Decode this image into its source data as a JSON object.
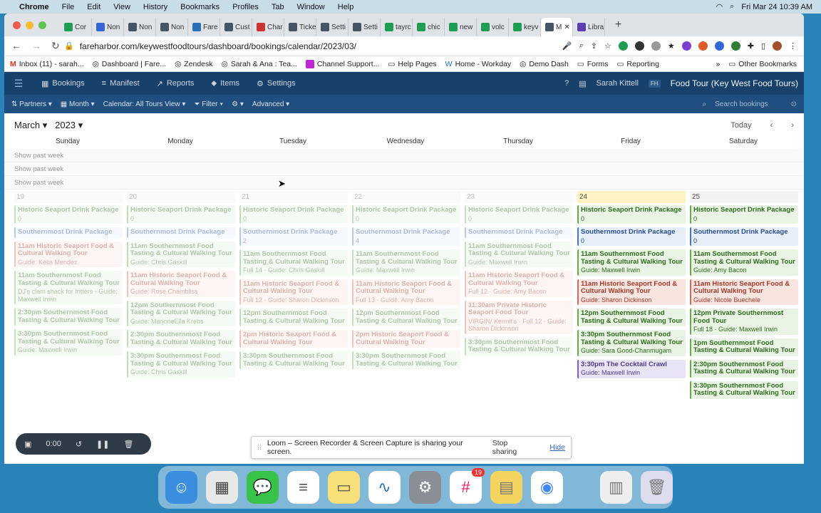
{
  "menubar": {
    "app": "Chrome",
    "items": [
      "File",
      "Edit",
      "View",
      "History",
      "Bookmarks",
      "Profiles",
      "Tab",
      "Window",
      "Help"
    ],
    "clock": "Fri Mar 24  10:39 AM"
  },
  "tabs": [
    "Cor",
    "Non",
    "Non",
    "Non",
    "Fare",
    "Cust",
    "Char",
    "Ticke",
    "Setti",
    "Setti",
    "tayrc",
    "chic",
    "new",
    "volc",
    "keyv",
    "M",
    "Libra"
  ],
  "url": "fareharbor.com/keywestfoodtours/dashboard/bookings/calendar/2023/03/",
  "bookmarks": [
    "Inbox (11) - sarah...",
    "Dashboard | Fare...",
    "Zendesk",
    "Sarah & Ana : Tea...",
    "Channel Support...",
    "Help Pages",
    "Home - Workday",
    "Demo Dash",
    "Forms",
    "Reporting"
  ],
  "other_bookmarks": "Other Bookmarks",
  "nav": {
    "items": [
      "Bookings",
      "Manifest",
      "Reports",
      "Items",
      "Settings"
    ],
    "user": "Sarah Kittell",
    "user_tag": "FH",
    "brand": "Food Tour (Key West Food Tours)"
  },
  "filters": {
    "partners": "Partners",
    "month": "Month",
    "calendar": "Calendar: All Tours View",
    "filter": "Filter",
    "advanced": "Advanced",
    "search_placeholder": "Search bookings"
  },
  "calendar": {
    "month": "March",
    "year": "2023",
    "today": "Today",
    "weekdays": [
      "Sunday",
      "Monday",
      "Tuesday",
      "Wednesday",
      "Thursday",
      "Friday",
      "Saturday"
    ],
    "show_past_week": "Show past week",
    "days": [
      {
        "num": "19",
        "events": [
          {
            "c": "green",
            "t": "Historic Seaport Drink Package",
            "g": "0"
          },
          {
            "c": "blue",
            "t": "Southernmost Drink Package",
            "g": ""
          },
          {
            "c": "red",
            "t": "11am Historic Seaport Food & Cultural Walking Tour",
            "g": "Guide: Kelia Mendez"
          },
          {
            "c": "green",
            "t": "11am Southernmost Food Tasting & Cultural Walking Tour",
            "g": "DJ's clam shack for fritters · Guide: Maxwell Irwin"
          },
          {
            "c": "green",
            "t": "2:30pm Southernmost Food Tasting & Cultural Walking Tour",
            "g": ""
          },
          {
            "c": "green",
            "t": "3:30pm Southernmost Food Tasting & Cultural Walking Tour",
            "g": "Guide: Maxwell Irwin"
          }
        ]
      },
      {
        "num": "20",
        "events": [
          {
            "c": "green",
            "t": "Historic Seaport Drink Package",
            "g": "0"
          },
          {
            "c": "blue",
            "t": "Southernmost Drink Package",
            "g": ""
          },
          {
            "c": "green",
            "t": "11am Southernmost Food Tasting & Cultural Walking Tour",
            "g": "Guide: Chris Gaskill"
          },
          {
            "c": "red",
            "t": "11am Historic Seaport Food & Cultural Walking Tour",
            "g": "Guide: Rose Chambliss"
          },
          {
            "c": "green",
            "t": "12pm Southernmost Food Tasting & Cultural Walking Tour",
            "g": "Guide: MarjorieElla Krebs"
          },
          {
            "c": "green",
            "t": "2:30pm Southernmost Food Tasting & Cultural Walking Tour",
            "g": ""
          },
          {
            "c": "green",
            "t": "3:30pm Southernmost Food Tasting & Cultural Walking Tour",
            "g": "Guide: Chris Gaskill"
          }
        ]
      },
      {
        "num": "21",
        "events": [
          {
            "c": "green",
            "t": "Historic Seaport Drink Package",
            "g": "0"
          },
          {
            "c": "blue",
            "t": "Southernmost Drink Package",
            "g": "2"
          },
          {
            "c": "green",
            "t": "11am Southernmost Food Tasting & Cultural Walking Tour",
            "g": "Full 14 · Guide: Chris Gaskill"
          },
          {
            "c": "red",
            "t": "11am Historic Seaport Food & Cultural Walking Tour",
            "g": "Full 12 · Guide: Sharon Dickinson"
          },
          {
            "c": "green",
            "t": "12pm Southernmost Food Tasting & Cultural Walking Tour",
            "g": ""
          },
          {
            "c": "red",
            "t": "2pm Historic Seaport Food & Cultural Walking Tour",
            "g": ""
          },
          {
            "c": "green",
            "t": "3:30pm Southernmost Food Tasting & Cultural Walking Tour",
            "g": ""
          }
        ]
      },
      {
        "num": "22",
        "events": [
          {
            "c": "green",
            "t": "Historic Seaport Drink Package",
            "g": "0"
          },
          {
            "c": "blue",
            "t": "Southernmost Drink Package",
            "g": "4"
          },
          {
            "c": "green",
            "t": "11am Southernmost Food Tasting & Cultural Walking Tour",
            "g": "Guide: Maxwell Irwin"
          },
          {
            "c": "red",
            "t": "11am Historic Seaport Food & Cultural Walking Tour",
            "g": "Full 13 · Guide: Amy Bacon"
          },
          {
            "c": "green",
            "t": "12pm Southernmost Food Tasting & Cultural Walking Tour",
            "g": ""
          },
          {
            "c": "red",
            "t": "2pm Historic Seaport Food & Cultural Walking Tour",
            "g": ""
          },
          {
            "c": "green",
            "t": "3:30pm Southernmost Food Tasting & Cultural Walking Tour",
            "g": ""
          }
        ]
      },
      {
        "num": "23",
        "events": [
          {
            "c": "green",
            "t": "Historic Seaport Drink Package",
            "g": "0"
          },
          {
            "c": "blue",
            "t": "Southernmost Drink Package",
            "g": ""
          },
          {
            "c": "green",
            "t": "11am Southernmost Food Tasting & Cultural Walking Tour",
            "g": "Guide: Maxwell Irwin"
          },
          {
            "c": "red",
            "t": "11am Historic Seaport Food & Cultural Walking Tour",
            "g": "Full 12 · Guide: Amy Bacon"
          },
          {
            "c": "red",
            "t": "11:30am Private Historic Seaport Food Tour",
            "g": "VIRGIN/ Kermit's · Full 12 · Guide: Sharon Dickinson"
          },
          {
            "c": "green",
            "t": "3:30pm Southernmost Food Tasting & Cultural Walking Tour",
            "g": ""
          }
        ]
      },
      {
        "num": "24",
        "events": [
          {
            "c": "green",
            "t": "Historic Seaport Drink Package",
            "g": "0"
          },
          {
            "c": "blue",
            "t": "Southernmost Drink Package",
            "g": "0"
          },
          {
            "c": "green",
            "t": "11am Southernmost Food Tasting & Cultural Walking Tour",
            "g": "Guide: Maxwell Irwin"
          },
          {
            "c": "red",
            "t": "11am Historic Seaport Food & Cultural Walking Tour",
            "g": "Guide: Sharon Dickinson"
          },
          {
            "c": "green",
            "t": "12pm Southernmost Food Tasting & Cultural Walking Tour",
            "g": ""
          },
          {
            "c": "green",
            "t": "3:30pm Southernmost Food Tasting & Cultural Walking Tour",
            "g": "Guide: Sara Good-Chanmugam"
          },
          {
            "c": "purple",
            "t": "3:30pm The Cocktail Crawl",
            "g": "Guide: Maxwell Irwin"
          }
        ]
      },
      {
        "num": "25",
        "events": [
          {
            "c": "green",
            "t": "Historic Seaport Drink Package",
            "g": "0"
          },
          {
            "c": "blue",
            "t": "Southernmost Drink Package",
            "g": "0"
          },
          {
            "c": "green",
            "t": "11am Southernmost Food Tasting & Cultural Walking Tour",
            "g": "Guide: Amy Bacon"
          },
          {
            "c": "red",
            "t": "11am Historic Seaport Food & Cultural Walking Tour",
            "g": "Guide: Nicole Buechele"
          },
          {
            "c": "green",
            "t": "12pm Private Southernmost Food Tour",
            "g": "Full 18 · Guide: Maxwell Irwin"
          },
          {
            "c": "green",
            "t": "1pm Southernmost Food Tasting & Cultural Walking Tour",
            "g": ""
          },
          {
            "c": "green",
            "t": "2:30pm Southernmost Food Tasting & Cultural Walking Tour",
            "g": ""
          },
          {
            "c": "green",
            "t": "3:30pm Southernmost Food Tasting & Cultural Walking Tour",
            "g": ""
          }
        ]
      }
    ]
  },
  "loom": {
    "message": "Loom – Screen Recorder & Screen Capture is sharing your screen.",
    "stop": "Stop sharing",
    "hide": "Hide",
    "timer": "0:00"
  },
  "dock_badge": "19",
  "colors": {
    "nav": "#17406a",
    "accent": "#2a83b8"
  }
}
